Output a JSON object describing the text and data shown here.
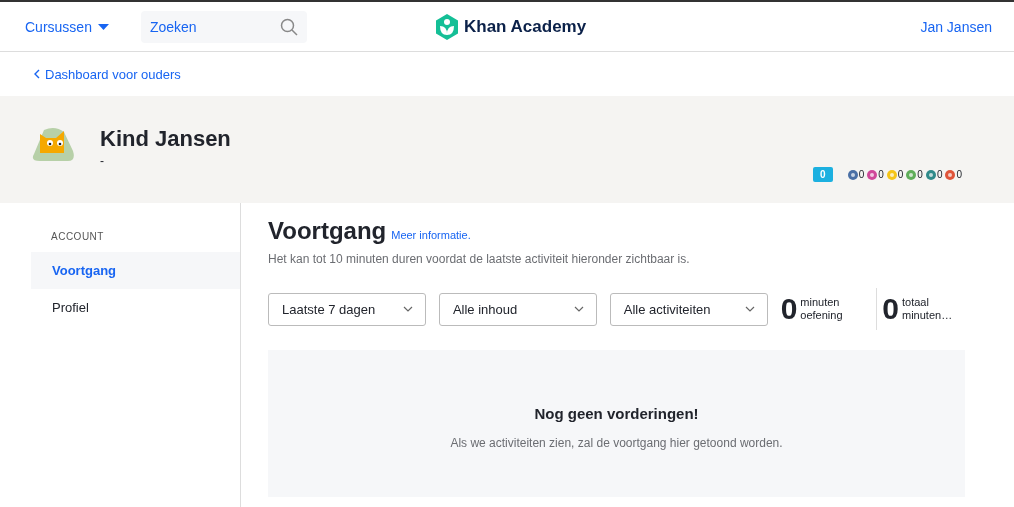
{
  "header": {
    "courses_menu": "Cursussen",
    "search": {
      "placeholder": "Zoeken"
    },
    "logo_text": "Khan Academy",
    "user": "Jan Jansen"
  },
  "breadcrumb": "Dashboard voor ouders",
  "profile": {
    "name": "Kind Jansen",
    "subtitle": "-",
    "points": "0",
    "badges": [
      {
        "color": "#4a6fa5",
        "count": "0"
      },
      {
        "color": "#d0489a",
        "count": "0"
      },
      {
        "color": "#f5c518",
        "count": "0"
      },
      {
        "color": "#5fae5a",
        "count": "0"
      },
      {
        "color": "#2f8a8a",
        "count": "0"
      },
      {
        "color": "#e0553a",
        "count": "0"
      }
    ]
  },
  "sidebar": {
    "heading": "ACCOUNT",
    "items": [
      {
        "label": "Voortgang",
        "selected": true
      },
      {
        "label": "Profiel",
        "selected": false
      }
    ]
  },
  "progress": {
    "title": "Voortgang",
    "info_link": "Meer informatie.",
    "note": "Het kan tot 10 minuten duren voordat de laatste activiteit hieronder zichtbaar is.",
    "filters": [
      "Laatste 7 dagen",
      "Alle inhoud",
      "Alle activiteiten"
    ],
    "stats": [
      {
        "value": "0",
        "label": "minuten oefening"
      },
      {
        "value": "0",
        "label": "totaal minuten…"
      }
    ],
    "empty": {
      "title": "Nog geen vorderingen!",
      "text": "Als we activiteiten zien, zal de voortgang hier getoond worden."
    }
  }
}
